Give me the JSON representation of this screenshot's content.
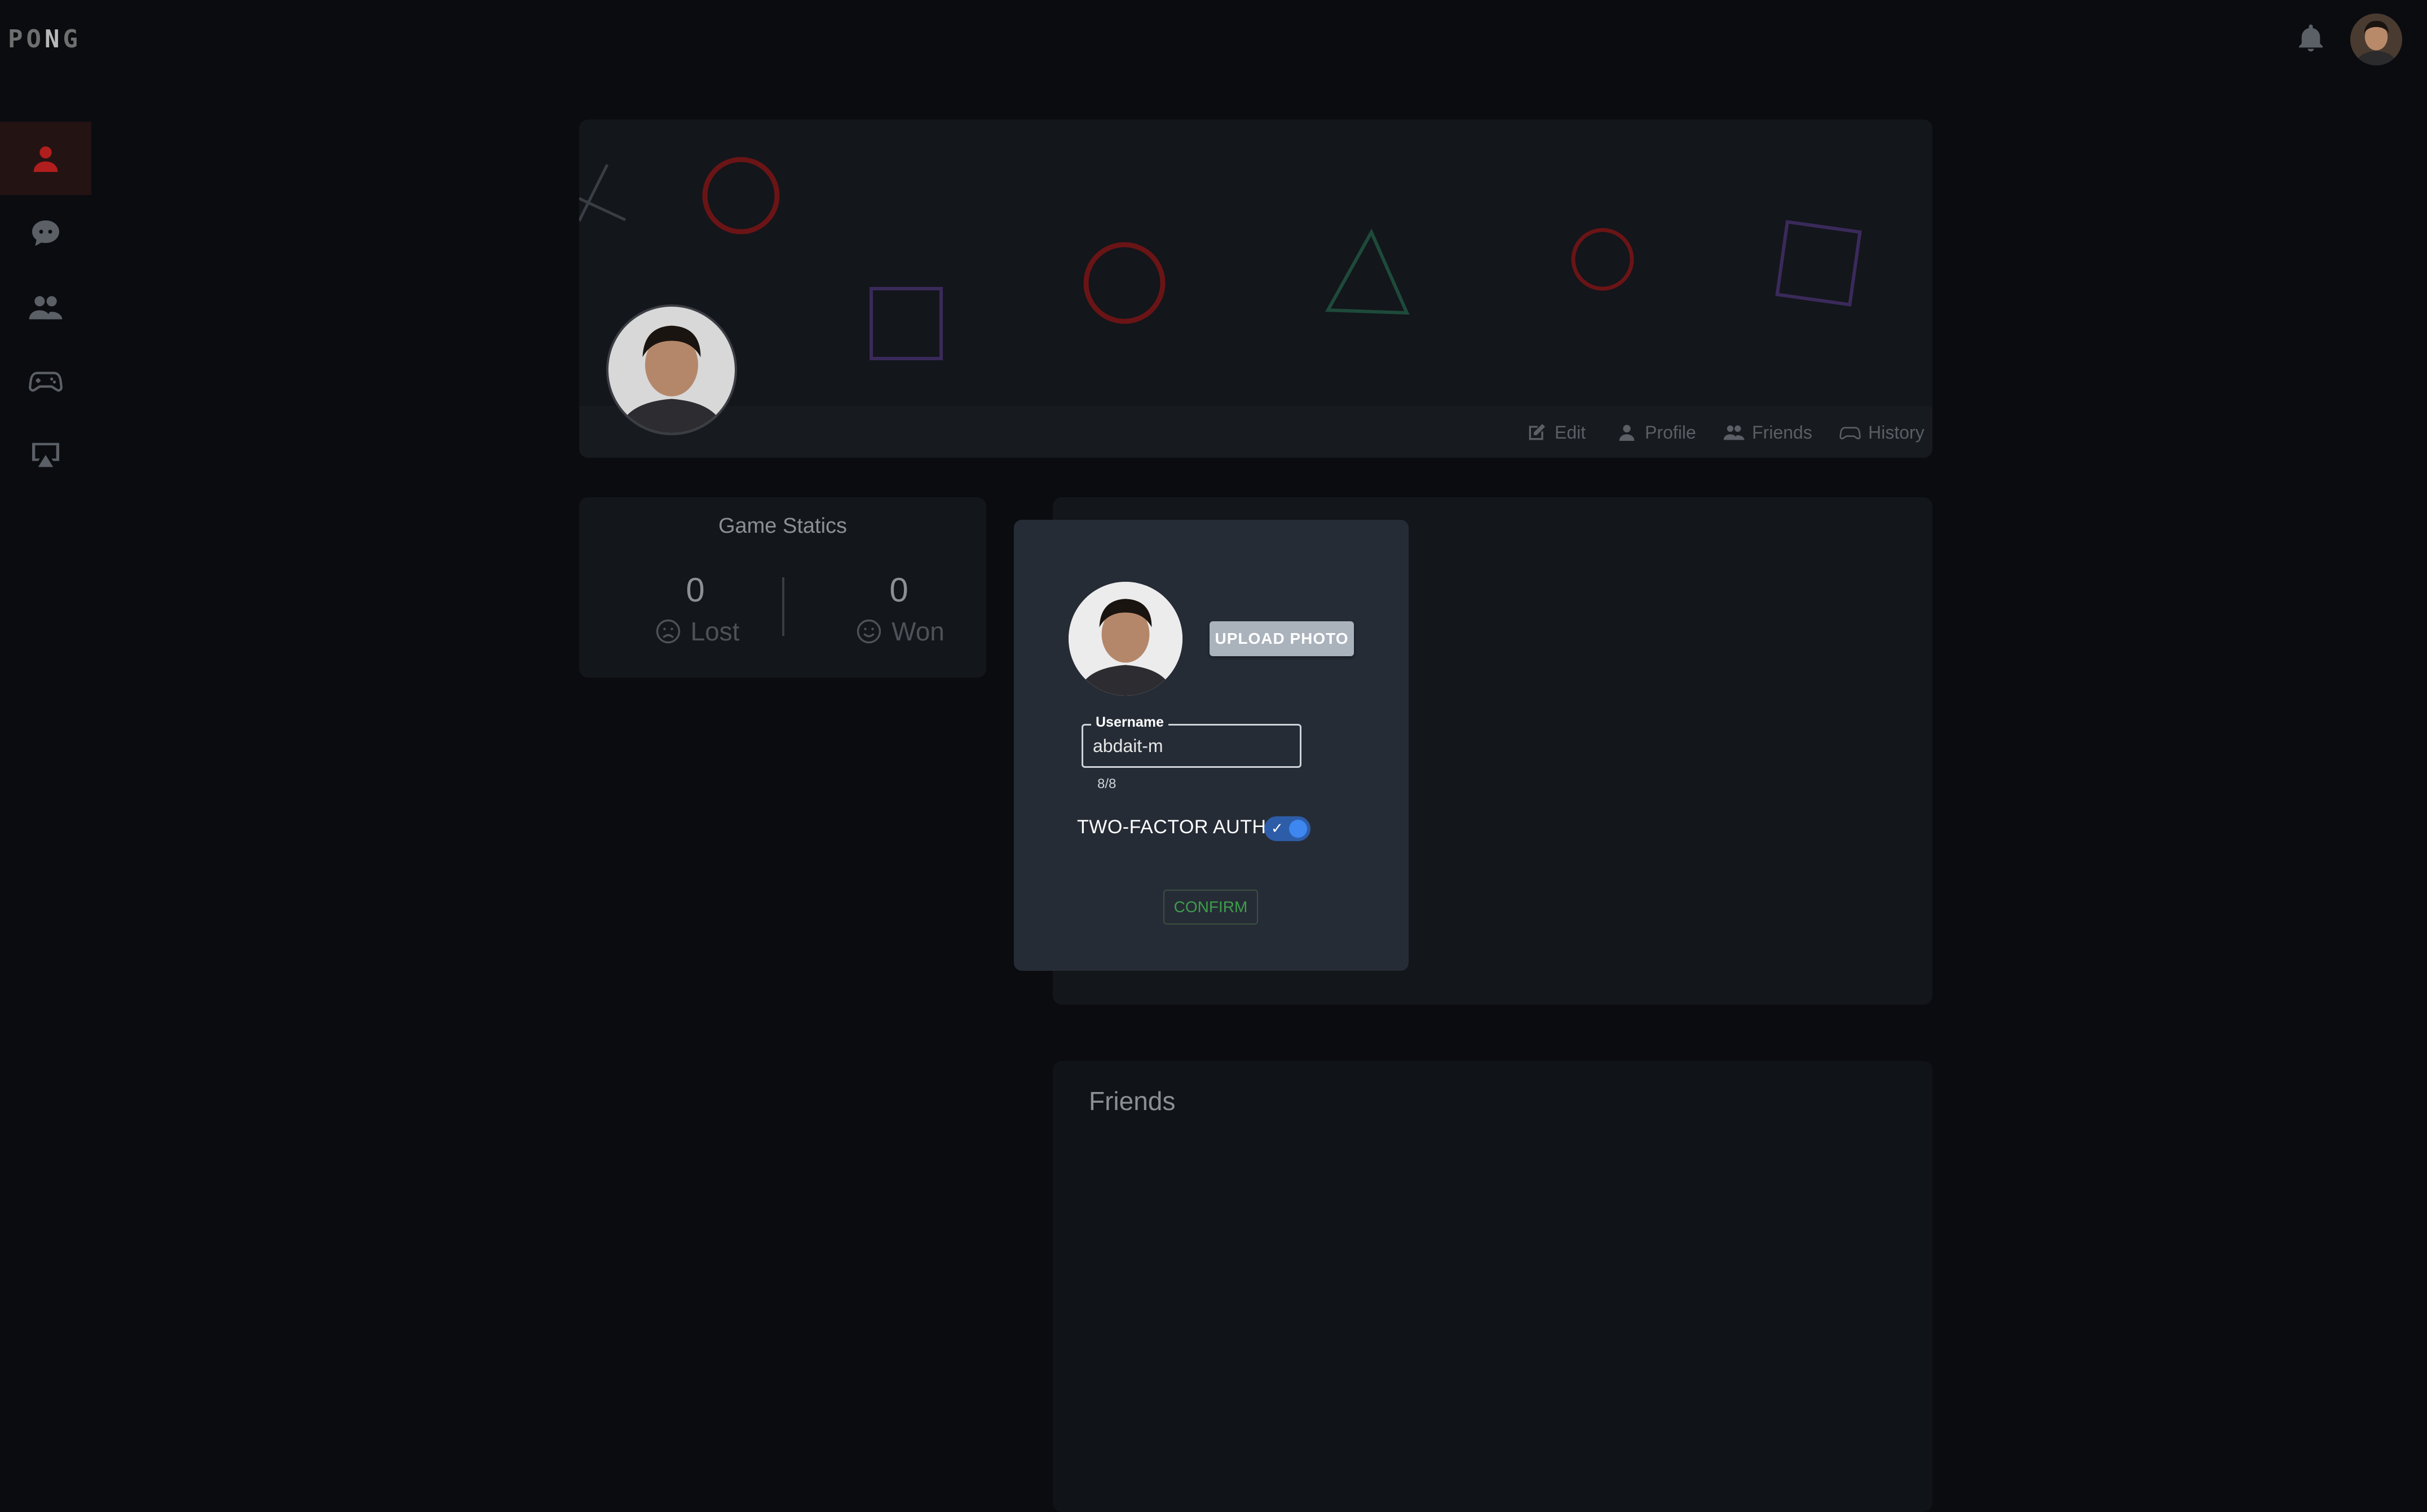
{
  "app": {
    "logo_left": "PO",
    "logo_n": "N",
    "logo_right": "G"
  },
  "sidebar": {
    "items": [
      {
        "name": "profile",
        "icon": "user-icon",
        "active": true
      },
      {
        "name": "chat",
        "icon": "chat-bubbles-icon",
        "active": false
      },
      {
        "name": "friends",
        "icon": "users-icon",
        "active": false
      },
      {
        "name": "game",
        "icon": "gamepad-icon",
        "active": false
      },
      {
        "name": "stream",
        "icon": "screen-cast-icon",
        "active": false
      }
    ]
  },
  "banner": {
    "tabs": [
      {
        "label": "Edit",
        "icon": "edit-icon"
      },
      {
        "label": "Profile",
        "icon": "user-icon"
      },
      {
        "label": "Friends",
        "icon": "users-icon"
      },
      {
        "label": "History",
        "icon": "gamepad-icon"
      }
    ]
  },
  "stats": {
    "title": "Game Statics",
    "lost": {
      "value": "0",
      "label": "Lost",
      "icon": "sad-face-icon"
    },
    "won": {
      "value": "0",
      "label": "Won",
      "icon": "smile-face-icon"
    }
  },
  "friends": {
    "title": "Friends"
  },
  "modal": {
    "upload_label": "UPLOAD PHOTO",
    "username_label": "Username",
    "username_value": "abdait-m",
    "counter": "8/8",
    "tfa_label": "TWO-FACTOR AUTH",
    "tfa_enabled": true,
    "confirm_label": "CONFIRM"
  },
  "colors": {
    "background": "#0a0c10",
    "panel": "#13161b",
    "modal": "#262c36",
    "accent_red": "#b01e1e",
    "toggle_blue": "#3e86f0",
    "confirm_green": "#3e9e4a"
  }
}
